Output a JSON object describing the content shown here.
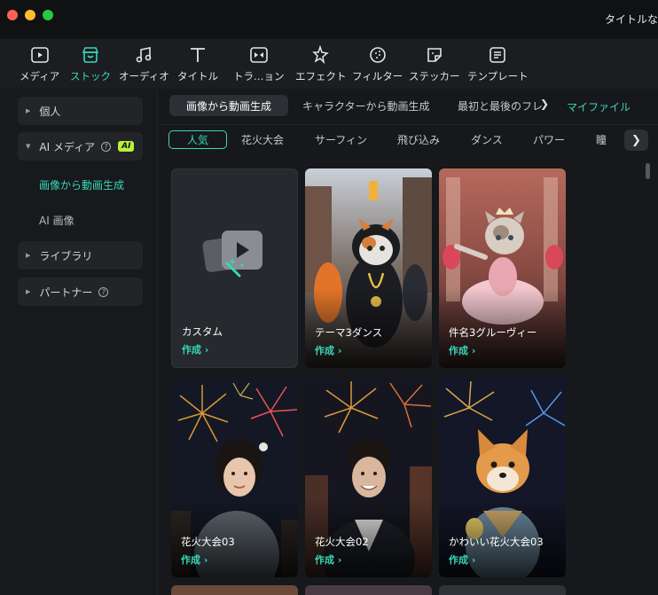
{
  "window": {
    "title": "タイトルな"
  },
  "toolbar": {
    "items": [
      {
        "label": "メディア",
        "icon": "media-icon"
      },
      {
        "label": "ストック",
        "icon": "stock-icon",
        "active": true
      },
      {
        "label": "オーディオ",
        "icon": "music-note-icon"
      },
      {
        "label": "タイトル",
        "icon": "text-t-icon"
      },
      {
        "label": "トラ…ョン",
        "icon": "transition-icon"
      },
      {
        "label": "エフェクト",
        "icon": "effect-sparkle-icon"
      },
      {
        "label": "フィルター",
        "icon": "filter-icon"
      },
      {
        "label": "ステッカー",
        "icon": "sticker-icon"
      },
      {
        "label": "テンプレート",
        "icon": "template-icon"
      }
    ],
    "accent": "#39d7b8"
  },
  "sidebar": {
    "personal": "個人",
    "ai_media": "AI メディア",
    "ai_badge": "AI",
    "ai_sub": [
      "画像から動画生成",
      "AI 画像"
    ],
    "library": "ライブラリ",
    "partner": "パートナー"
  },
  "tabs": {
    "items": [
      "画像から動画生成",
      "キャラクターから動画生成",
      "最初と最後のフレ"
    ],
    "arrow": "❯",
    "my_file": "マイファイル"
  },
  "chips": {
    "items": [
      "人気",
      "花火大会",
      "サーフィン",
      "飛び込み",
      "ダンス",
      "パワー",
      "瞳"
    ],
    "next": "❯"
  },
  "cards": [
    {
      "title": "カスタム",
      "action": "作成 ›"
    },
    {
      "title": "テーマ3ダンス",
      "action": "作成 ›"
    },
    {
      "title": "件名3グルーヴィー",
      "action": "作成 ›"
    },
    {
      "title": "花火大会03",
      "action": "作成 ›"
    },
    {
      "title": "花火大会02",
      "action": "作成 ›"
    },
    {
      "title": "かわいい花火大会03",
      "action": "作成 ›"
    }
  ]
}
